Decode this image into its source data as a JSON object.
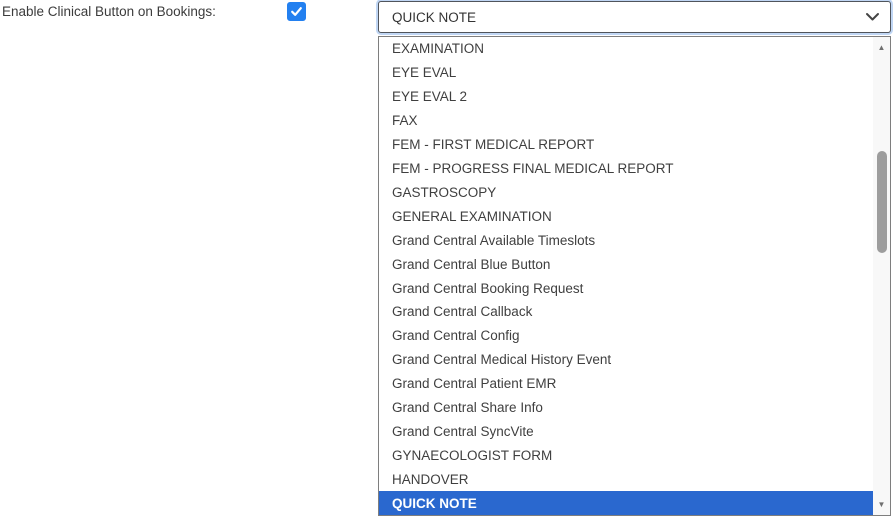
{
  "form": {
    "label": "Enable Clinical Button on Bookings:",
    "checkbox_checked": true
  },
  "select": {
    "value": "QUICK NOTE",
    "chevron_icon": "chevron-down-icon"
  },
  "dropdown": {
    "options": [
      "EXAMINATION",
      "EYE EVAL",
      "EYE EVAL 2",
      "FAX",
      "FEM - FIRST MEDICAL REPORT",
      "FEM - PROGRESS FINAL MEDICAL REPORT",
      "GASTROSCOPY",
      "GENERAL EXAMINATION",
      "Grand Central Available Timeslots",
      "Grand Central Blue Button",
      "Grand Central Booking Request",
      "Grand Central Callback",
      "Grand Central Config",
      "Grand Central Medical History Event",
      "Grand Central Patient EMR",
      "Grand Central Share Info",
      "Grand Central SyncVite",
      "GYNAECOLOGIST FORM",
      "HANDOVER",
      "QUICK NOTE"
    ],
    "selected": "QUICK NOTE",
    "selected_index": 19,
    "scrollbar": {
      "up_icon": "scroll-up-icon",
      "down_icon": "scroll-down-icon",
      "up_glyph": "▲",
      "down_glyph": "▼"
    }
  },
  "icons": {
    "checkbox": "checkmark-icon"
  },
  "colors": {
    "checkbox_blue": "#2380f0",
    "highlight_blue": "#2a68cf",
    "item_text": "#3f3f3f",
    "label_text": "#3c3c3c",
    "select_border": "#50555c",
    "dropdown_border": "#7e7e7e",
    "scrollbar_track": "#f8f8f8",
    "scrollbar_thumb": "#9d9d9d"
  }
}
